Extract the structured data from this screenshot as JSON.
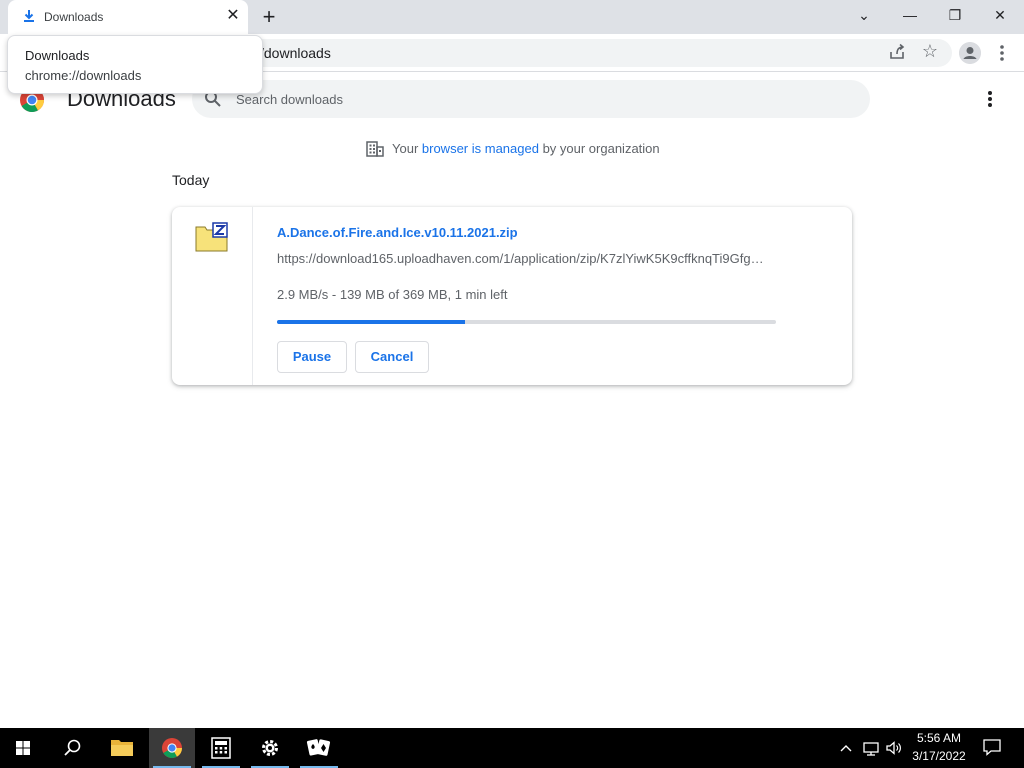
{
  "tab": {
    "title": "Downloads",
    "close_glyph": "✕",
    "icon": "download-icon"
  },
  "new_tab_glyph": "+",
  "window": {
    "tab_search_glyph": "⌄",
    "minimize_glyph": "—",
    "maximize_glyph": "❐",
    "close_glyph": "✕"
  },
  "omnibox": {
    "visible_text": "/downloads"
  },
  "tooltip": {
    "title": "Downloads",
    "url": "chrome://downloads"
  },
  "page": {
    "title": "Downloads",
    "search_placeholder": "Search downloads",
    "managed_prefix": "Your ",
    "managed_link": "browser is managed",
    "managed_suffix": " by your organization",
    "date_heading": "Today"
  },
  "download": {
    "file_name": "A.Dance.of.Fire.and.Ice.v10.11.2021.zip",
    "url": "https://download165.uploadhaven.com/1/application/zip/K7zlYiwK5K9cffknqTi9Gfg…",
    "status": "2.9 MB/s - 139 MB of 369 MB, 1 min left",
    "progress_fraction": 0.3767,
    "pause_label": "Pause",
    "cancel_label": "Cancel"
  },
  "taskbar": {
    "time": "5:56 AM",
    "date": "3/17/2022"
  },
  "colors": {
    "accent": "#1a73e8",
    "titlebar": "#dee1e6",
    "taskbar": "#000000"
  }
}
